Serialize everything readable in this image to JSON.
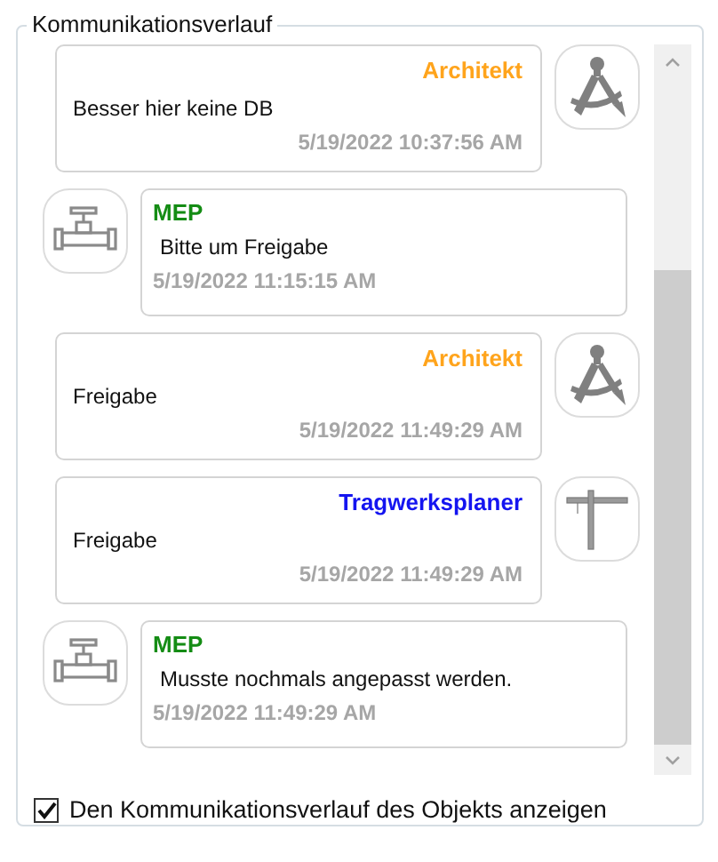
{
  "group": {
    "title": "Kommunikationsverlauf"
  },
  "messages": [
    {
      "kind": "compass",
      "sender": "Architekt",
      "color": "#ffa41c",
      "text": "Besser hier keine DB",
      "time": "5/19/2022 10:37:56 AM"
    },
    {
      "kind": "valve",
      "sender": "MEP",
      "color": "#148c14",
      "text": "Bitte um Freigabe",
      "time": "5/19/2022 11:15:15 AM"
    },
    {
      "kind": "compass",
      "sender": "Architekt",
      "color": "#ffa41c",
      "text": "Freigabe",
      "time": "5/19/2022 11:49:29 AM"
    },
    {
      "kind": "crane",
      "sender": "Tragwerksplaner",
      "color": "#1414f0",
      "text": "Freigabe",
      "time": "5/19/2022 11:49:29 AM"
    },
    {
      "kind": "valve",
      "sender": "MEP",
      "color": "#148c14",
      "text": "Musste nochmals angepasst werden.",
      "time": "5/19/2022 11:49:29 AM"
    }
  ],
  "show_history": {
    "label": "Den Kommunikationsverlauf des Objekts anzeigen",
    "checked": true
  }
}
